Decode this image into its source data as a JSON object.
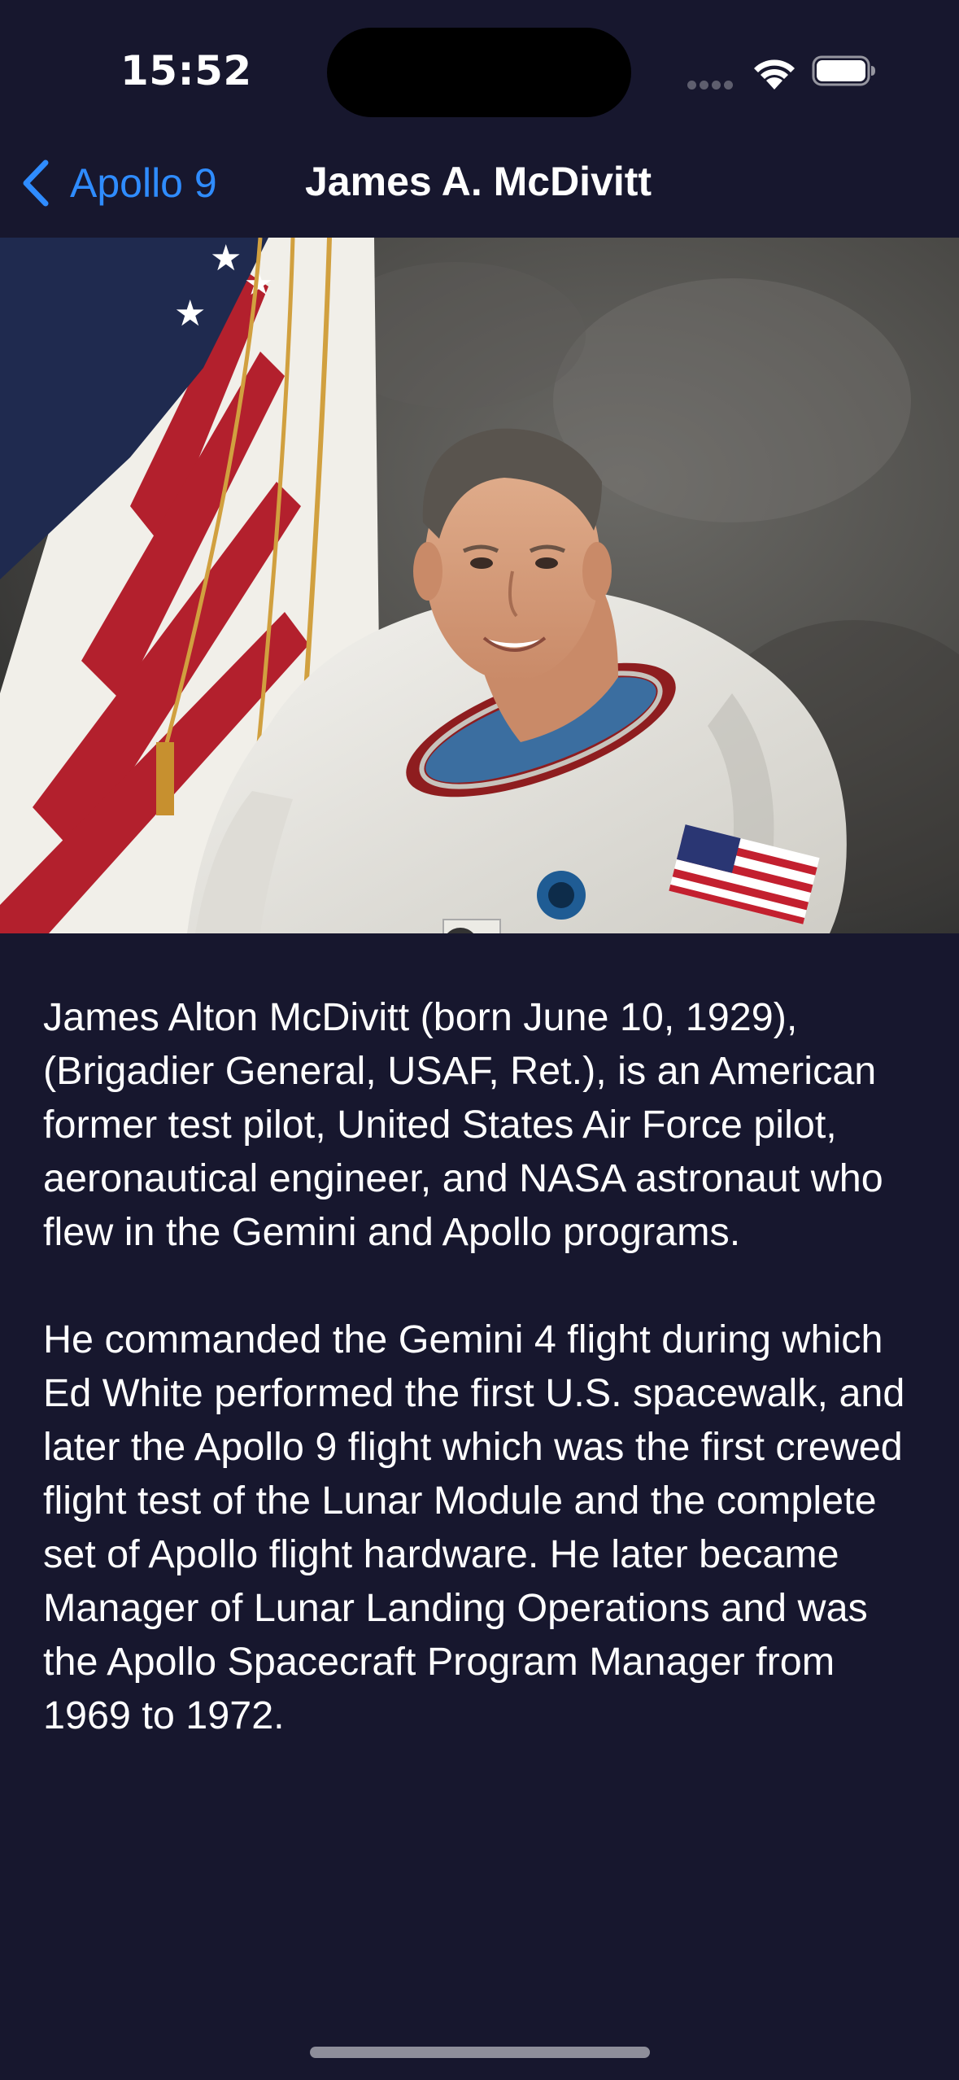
{
  "status_bar": {
    "time": "15:52"
  },
  "nav": {
    "back_label": "Apollo 9",
    "title": "James A. McDivitt"
  },
  "photo": {
    "alt": "James A. McDivitt"
  },
  "bio": {
    "paragraph_1": "James Alton McDivitt (born June 10, 1929), (Brigadier General, USAF, Ret.), is an American former test pilot, United States Air Force pilot, aeronautical engineer, and NASA astronaut who flew in the Gemini and Apollo programs.",
    "paragraph_2": "He commanded the Gemini 4 flight during which Ed White performed the first U.S. spacewalk, and later the Apollo 9 flight which was the first crewed flight test of the Lunar Module and the complete set of Apollo flight hardware. He later became Manager of Lunar Landing Operations and was the Apollo Spacecraft Program Manager from 1969 to 1972."
  },
  "colors": {
    "background": "#17172e",
    "accent": "#2f8cff",
    "text": "#ffffff"
  },
  "icons": {
    "back": "chevron-left-icon",
    "wifi": "wifi-icon",
    "battery": "battery-icon",
    "signal": "cellular-signal-icon"
  }
}
